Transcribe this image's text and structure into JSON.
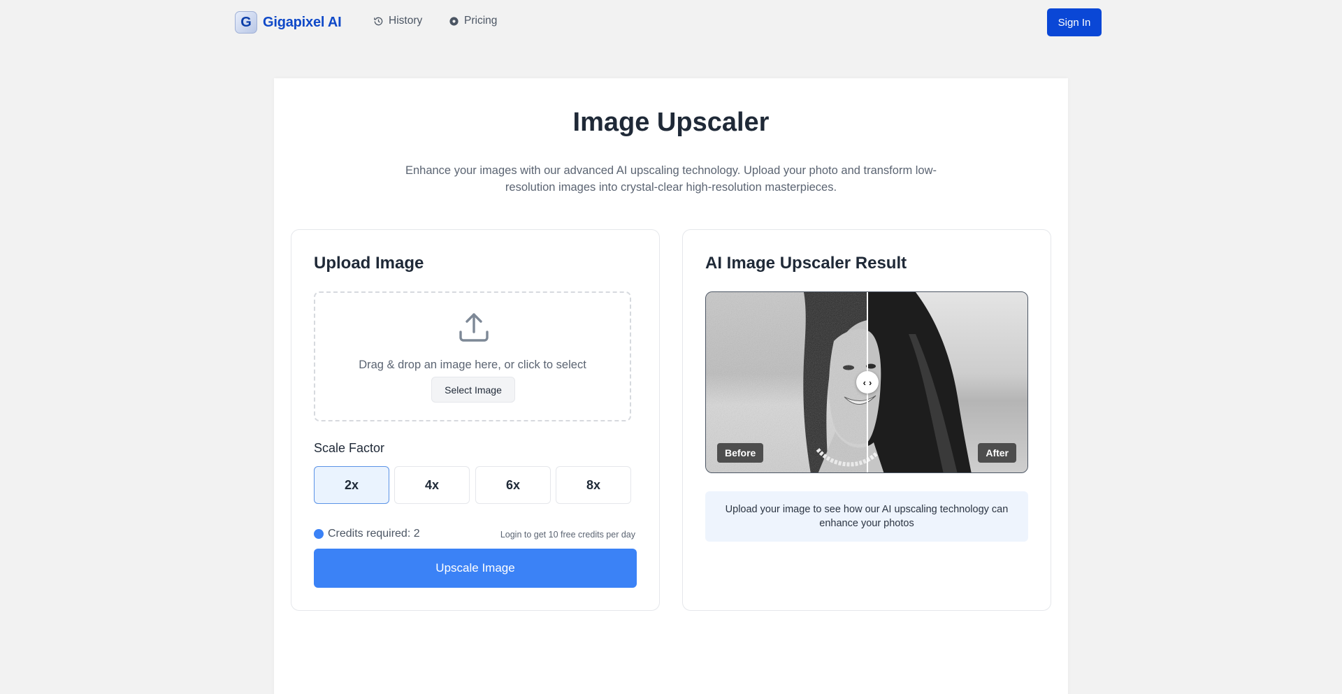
{
  "header": {
    "brand_logo_letter": "G",
    "brand_name": "Gigapixel AI",
    "nav": [
      {
        "label": "History",
        "icon": "history-icon"
      },
      {
        "label": "Pricing",
        "icon": "pricing-icon"
      }
    ],
    "sign_in_label": "Sign In"
  },
  "hero": {
    "title": "Image Upscaler",
    "subtitle": "Enhance your images with our advanced AI upscaling technology. Upload your photo and transform low-resolution images into crystal-clear high-resolution masterpieces."
  },
  "upload_panel": {
    "title": "Upload Image",
    "drop_text": "Drag & drop an image here, or click to select",
    "select_button": "Select Image",
    "scale_label": "Scale Factor",
    "scale_options": [
      "2x",
      "4x",
      "6x",
      "8x"
    ],
    "selected_scale": "2x",
    "credits_text": "Credits required: 2",
    "login_hint": "Login to get 10 free credits per day",
    "upscale_button": "Upscale Image"
  },
  "result_panel": {
    "title": "AI Image Upscaler Result",
    "before_label": "Before",
    "after_label": "After",
    "handle_left": "‹",
    "handle_right": "›",
    "info_text": "Upload your image to see how our AI upscaling technology can enhance your photos"
  },
  "colors": {
    "brand": "#0f49c8",
    "primary_button": "#3b82f6",
    "sign_in": "#0a47d6",
    "info_bg": "#eef4fd"
  }
}
